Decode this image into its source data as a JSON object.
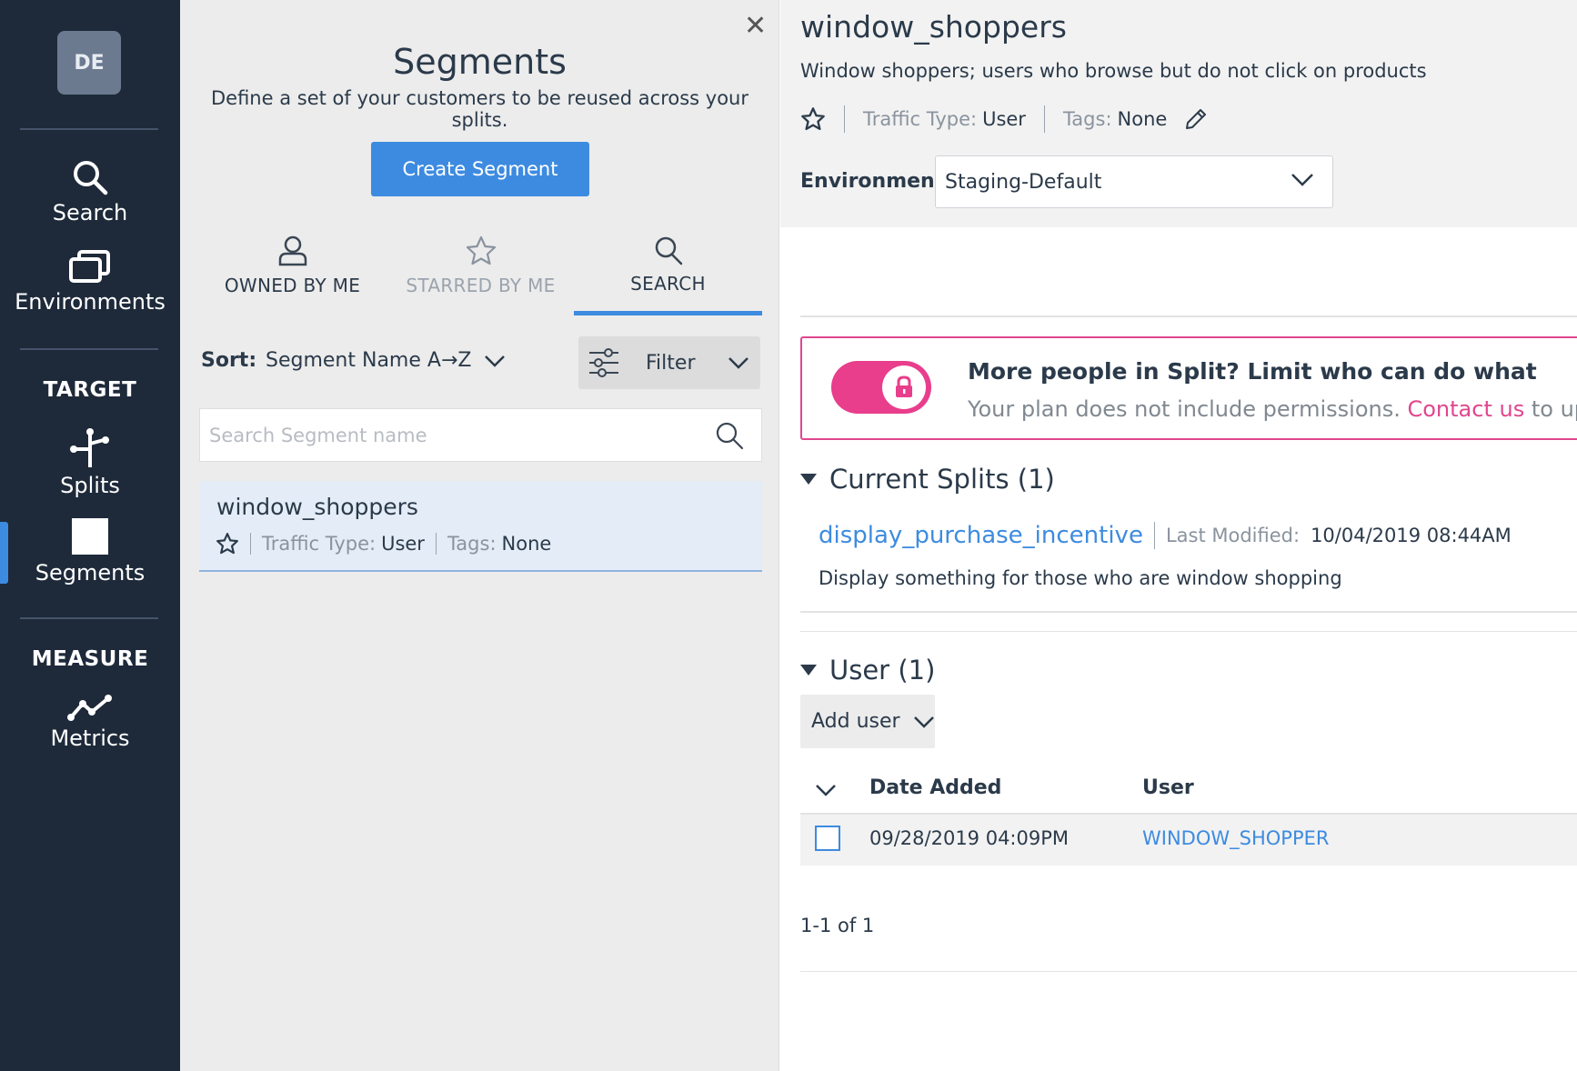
{
  "nav": {
    "avatar_initials": "DE",
    "items": [
      {
        "label": "Search",
        "icon": "search-icon"
      },
      {
        "label": "Environments",
        "icon": "environments-icon"
      },
      {
        "label": "Splits",
        "icon": "splits-icon"
      },
      {
        "label": "Segments",
        "icon": "segments-icon"
      },
      {
        "label": "Metrics",
        "icon": "metrics-icon"
      }
    ],
    "section_target": "TARGET",
    "section_measure": "MEASURE",
    "active_item": "Segments"
  },
  "segments_panel": {
    "close_icon": "close-icon",
    "title": "Segments",
    "subtitle": "Define a set of your customers to be reused across your splits.",
    "create_button": "Create Segment",
    "tabs": [
      {
        "label": "OWNED BY ME",
        "icon": "user-icon"
      },
      {
        "label": "STARRED BY ME",
        "icon": "star-icon"
      },
      {
        "label": "SEARCH",
        "icon": "search-icon"
      }
    ],
    "active_tab": "SEARCH",
    "sort_label": "Sort:",
    "sort_value": "Segment Name A→Z",
    "filter_label": "Filter",
    "search_placeholder": "Search Segment name",
    "list": [
      {
        "name": "window_shoppers",
        "traffic_type_label": "Traffic Type:",
        "traffic_type": "User",
        "tags_label": "Tags:",
        "tags": "None"
      }
    ]
  },
  "detail": {
    "title": "window_shoppers",
    "description": "Window shoppers; users who browse but do not click on products",
    "traffic_type_label": "Traffic Type:",
    "traffic_type": "User",
    "tags_label": "Tags:",
    "tags": "None",
    "environment_label": "Environment",
    "environment_value": "Staging-Default",
    "upsell": {
      "heading": "More people in Split? Limit who can do what",
      "text": "Your plan does not include permissions.",
      "link": "Contact us",
      "rest": "to upg"
    },
    "current_splits": {
      "heading": "Current Splits (1)",
      "items": [
        {
          "name": "display_purchase_incentive",
          "modified_label": "Last Modified:",
          "modified": "10/04/2019 08:44AM",
          "description": "Display something for those who are window shopping"
        }
      ]
    },
    "users": {
      "heading": "User (1)",
      "add_user": "Add user",
      "columns": [
        "Date Added",
        "User"
      ],
      "rows": [
        {
          "date": "09/28/2019 04:09PM",
          "user": "WINDOW_SHOPPER"
        }
      ],
      "pagination": "1-1 of 1"
    }
  },
  "colors": {
    "nav_bg": "#1e2a3a",
    "accent": "#3d8be0",
    "pink": "#e0468e",
    "panel_bg": "#ececec"
  }
}
